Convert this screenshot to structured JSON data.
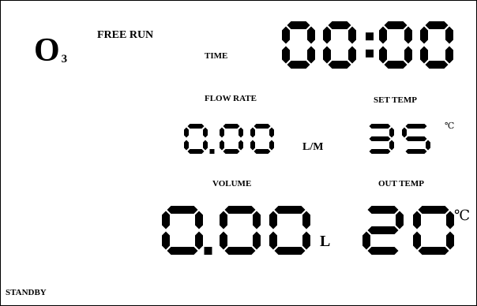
{
  "screen": {
    "gas_symbol": "O",
    "gas_subscript": "3",
    "mode_label": "FREE RUN",
    "time_label": "TIME",
    "time_value": "00:00",
    "flow_rate_label": "FLOW RATE",
    "flow_rate_value": "0.00",
    "flow_rate_unit": "L/M",
    "set_temp_label": "SET TEMP",
    "set_temp_value": "35",
    "set_temp_unit": "℃",
    "volume_label": "VOLUME",
    "volume_value": "0.00",
    "volume_unit": "L",
    "out_temp_label": "OUT TEMP",
    "out_temp_value": "20",
    "out_temp_unit": "℃",
    "status_text": "STANDBY"
  },
  "colors": {
    "segment": "#000000",
    "background": "#ffffff"
  }
}
